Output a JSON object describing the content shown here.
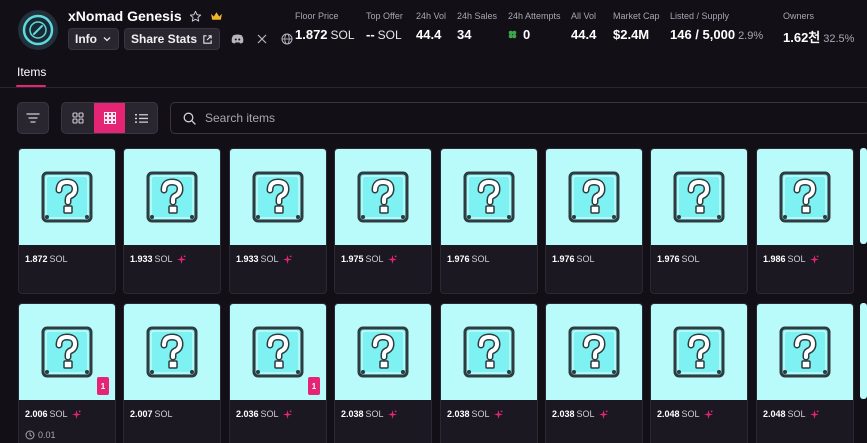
{
  "collection": {
    "name": "xNomad Genesis"
  },
  "buttons": {
    "info": "Info",
    "share": "Share Stats"
  },
  "stats": [
    {
      "label": "Floor Price",
      "value": "1.872",
      "unit": "SOL"
    },
    {
      "label": "Top Offer",
      "value": "--",
      "unit": "SOL"
    },
    {
      "label": "24h Vol",
      "value": "44.4"
    },
    {
      "label": "24h Sales",
      "value": "34"
    },
    {
      "label": "24h Attempts",
      "value": "0"
    },
    {
      "label": "All Vol",
      "value": "44.4"
    },
    {
      "label": "Market Cap",
      "value": "$2.4M"
    },
    {
      "label": "Listed / Supply",
      "value": "146 / 5,000",
      "pct": "2.9%"
    },
    {
      "label": "Owners",
      "value": "1.62천",
      "pct": "32.5%"
    }
  ],
  "tabs": {
    "items": "Items"
  },
  "search": {
    "placeholder": "Search items"
  },
  "colors": {
    "accent": "#e42575",
    "card_bg": "#b9fbfb",
    "page_bg": "#120f17"
  },
  "cards": {
    "row1": [
      {
        "price": "1.872",
        "unit": "SOL",
        "sparkle": false
      },
      {
        "price": "1.933",
        "unit": "SOL",
        "sparkle": true
      },
      {
        "price": "1.933",
        "unit": "SOL",
        "sparkle": true
      },
      {
        "price": "1.975",
        "unit": "SOL",
        "sparkle": true
      },
      {
        "price": "1.976",
        "unit": "SOL",
        "sparkle": false
      },
      {
        "price": "1.976",
        "unit": "SOL",
        "sparkle": false
      },
      {
        "price": "1.976",
        "unit": "SOL",
        "sparkle": false
      },
      {
        "price": "1.986",
        "unit": "SOL",
        "sparkle": true
      }
    ],
    "row2": [
      {
        "price": "2.006",
        "unit": "SOL",
        "sparkle": true,
        "badge": "1",
        "extra": "0.01"
      },
      {
        "price": "2.007",
        "unit": "SOL",
        "sparkle": false
      },
      {
        "price": "2.036",
        "unit": "SOL",
        "sparkle": true,
        "badge": "1"
      },
      {
        "price": "2.038",
        "unit": "SOL",
        "sparkle": true
      },
      {
        "price": "2.038",
        "unit": "SOL",
        "sparkle": true
      },
      {
        "price": "2.038",
        "unit": "SOL",
        "sparkle": true
      },
      {
        "price": "2.048",
        "unit": "SOL",
        "sparkle": true
      },
      {
        "price": "2.048",
        "unit": "SOL",
        "sparkle": true
      }
    ]
  }
}
